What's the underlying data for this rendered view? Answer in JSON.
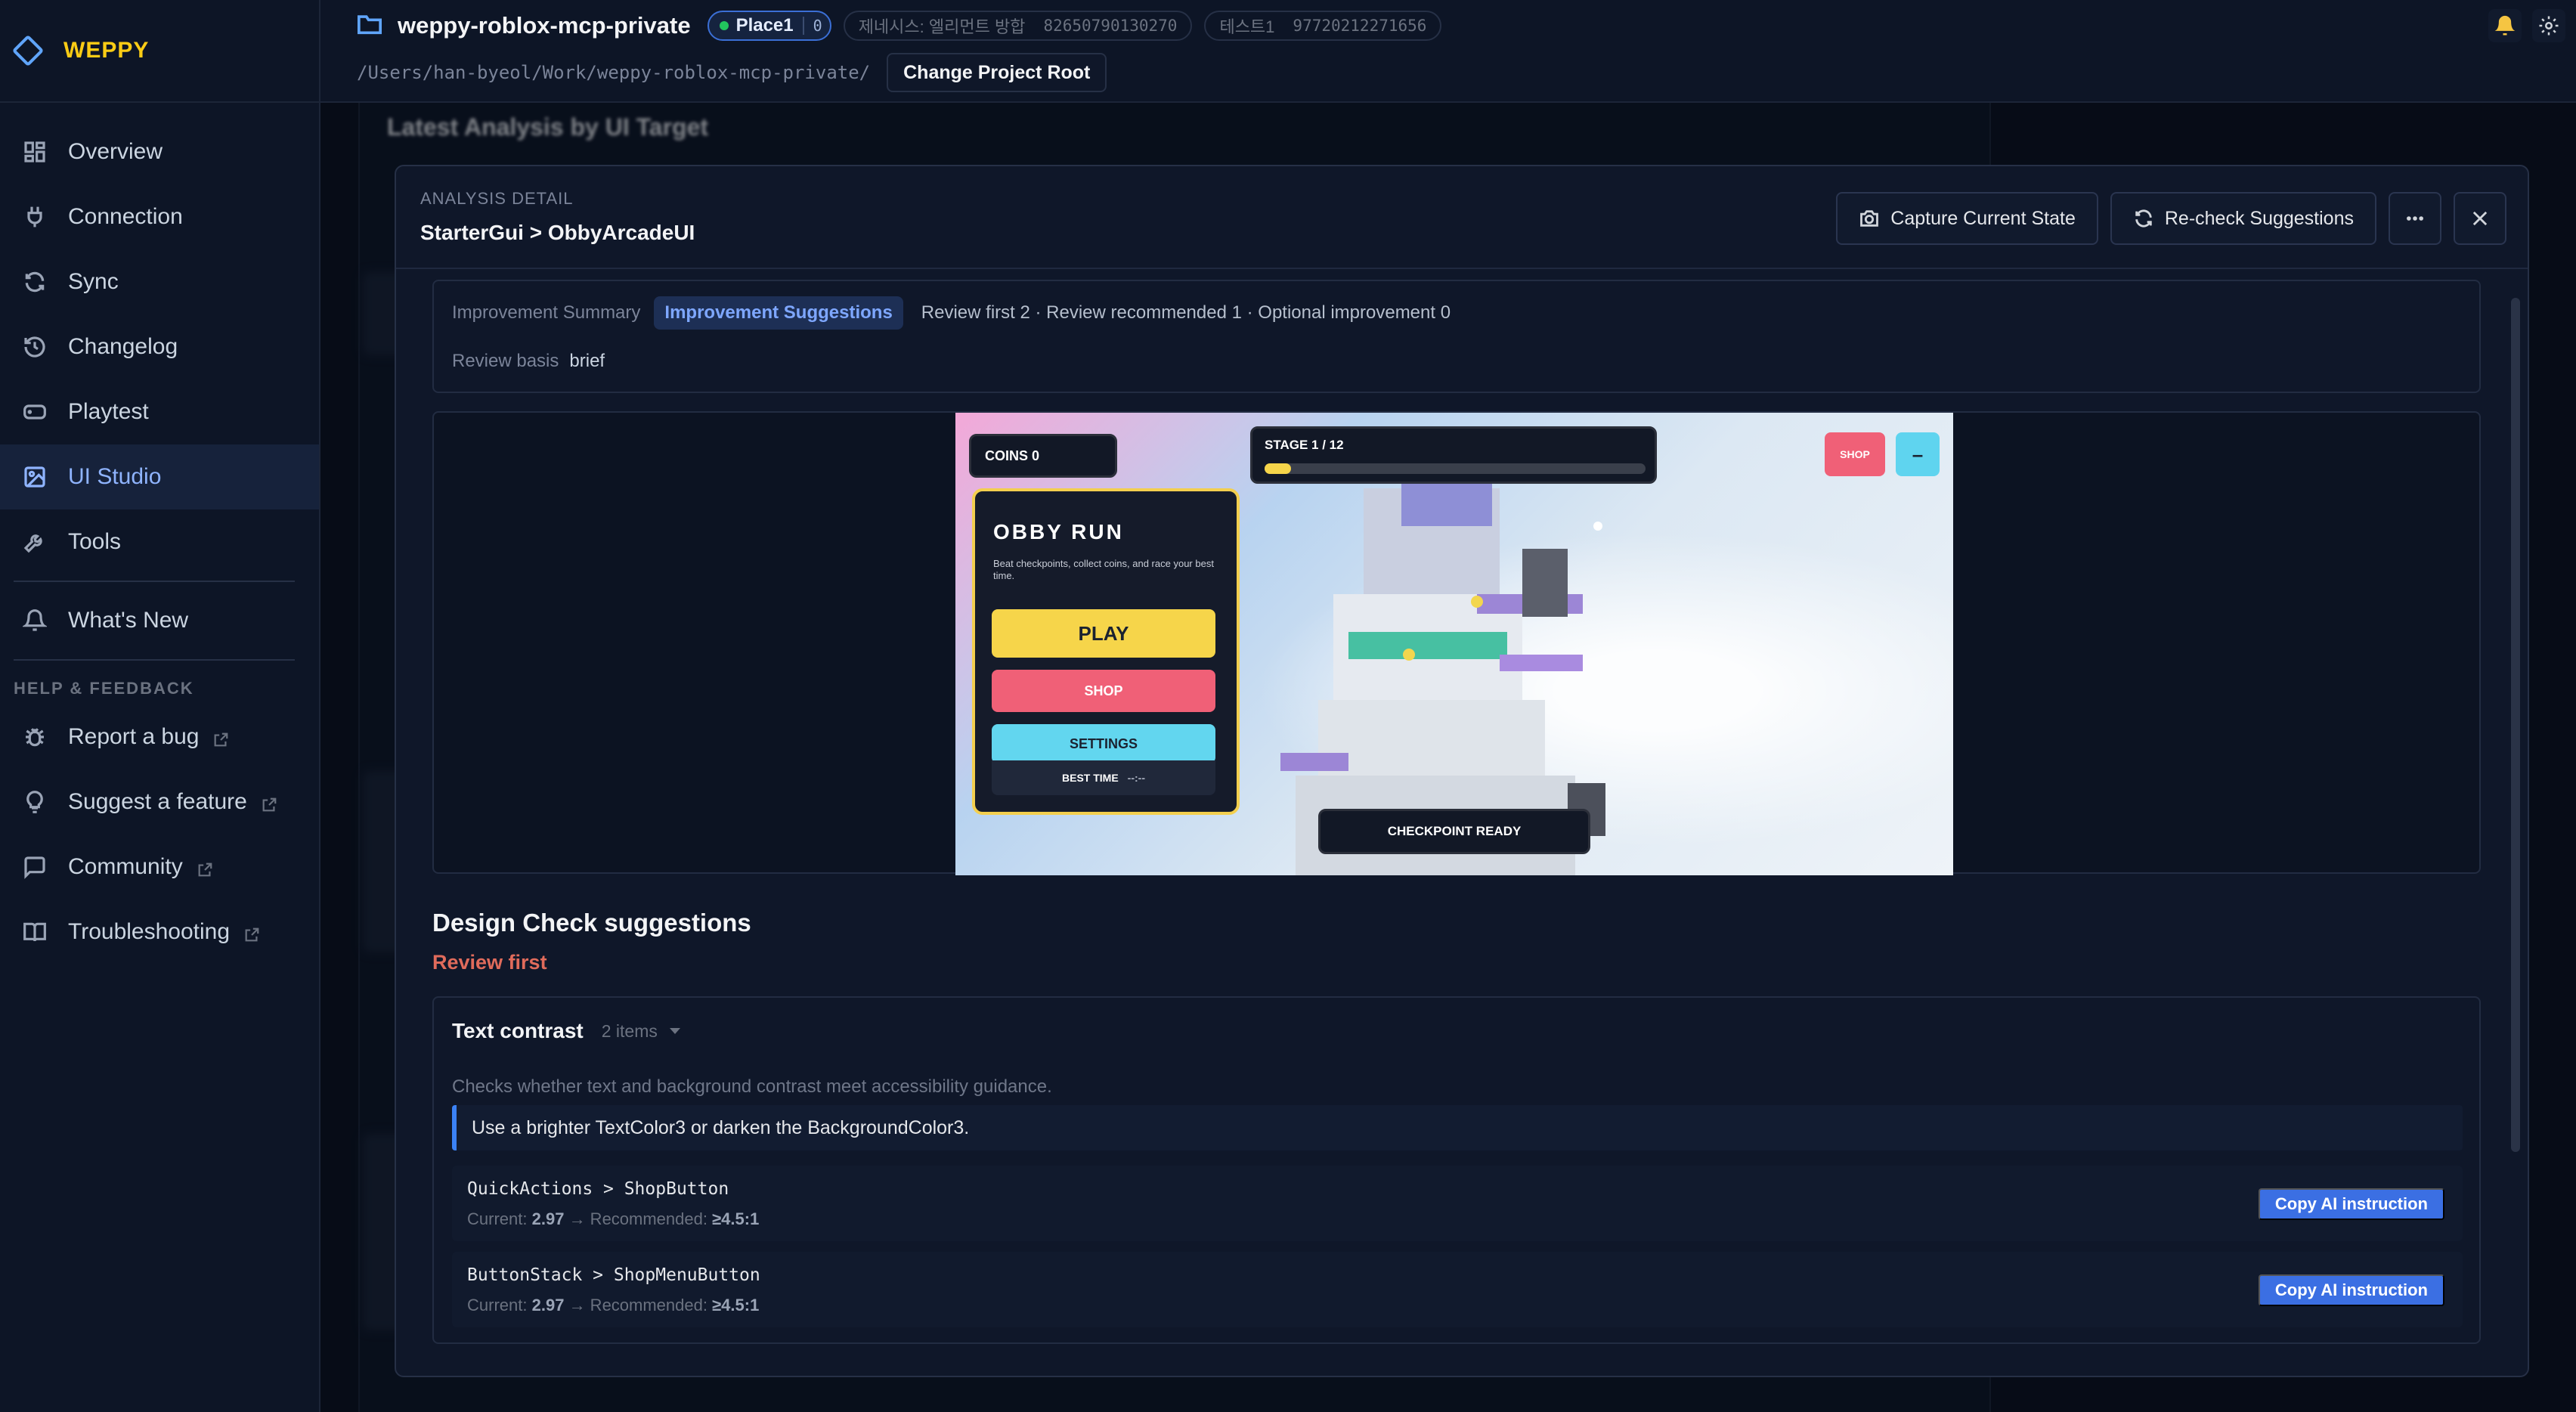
{
  "app": {
    "name": "WEPPY"
  },
  "sidebar": {
    "items": [
      {
        "label": "Overview"
      },
      {
        "label": "Connection"
      },
      {
        "label": "Sync"
      },
      {
        "label": "Changelog"
      },
      {
        "label": "Playtest"
      },
      {
        "label": "UI Studio"
      },
      {
        "label": "Tools"
      }
    ],
    "whats_new": "What's New",
    "help_section": "HELP & FEEDBACK",
    "help_items": [
      {
        "label": "Report a bug"
      },
      {
        "label": "Suggest a feature"
      },
      {
        "label": "Community"
      },
      {
        "label": "Troubleshooting"
      }
    ]
  },
  "header": {
    "project_name": "weppy-roblox-mcp-private",
    "place_label": "Place1",
    "place_count": "0",
    "pill1_name": "제네시스: 엘리먼트 방합",
    "pill1_id": "82650790130270",
    "pill2_name": "테스트1",
    "pill2_id": "97720212271656",
    "path": "/Users/han-byeol/Work/weppy-roblox-mcp-private/",
    "change_root": "Change Project Root"
  },
  "background": {
    "title": "Latest Analysis by UI Target"
  },
  "modal": {
    "kicker": "ANALYSIS DETAIL",
    "title": "StarterGui > ObbyArcadeUI",
    "capture_label": "Capture Current State",
    "recheck_label": "Re-check Suggestions",
    "tabs": {
      "summary_tab": "Improvement Summary",
      "suggestions_tab": "Improvement Suggestions",
      "summary_text": "Review first 2 · Review recommended 1 · Optional improvement 0"
    },
    "basis_label": "Review basis",
    "basis_value": "brief"
  },
  "game": {
    "coins": "COINS 0",
    "stage": "STAGE 1 / 12",
    "stage_progress": 0.07,
    "shop_small": "SHOP",
    "minimize": "–",
    "menu_title": "OBBY RUN",
    "menu_desc": "Beat checkpoints, collect coins, and race your best time.",
    "play": "PLAY",
    "shop": "SHOP",
    "settings": "SETTINGS",
    "best_time_label": "BEST TIME",
    "best_time_value": "--:--",
    "checkpoint": "CHECKPOINT READY"
  },
  "design_check": {
    "title": "Design Check suggestions",
    "review_first": "Review first",
    "card": {
      "name": "Text contrast",
      "count": "2 items",
      "desc": "Checks whether text and background contrast meet accessibility guidance.",
      "tip": "Use a brighter TextColor3 or darken the BackgroundColor3.",
      "rows": [
        {
          "path": "QuickActions > ShopButton",
          "current_label": "Current:",
          "current": "2.97",
          "rec_label": "→ Recommended:",
          "recommended": "≥4.5:1",
          "copy": "Copy AI instruction"
        },
        {
          "path": "ButtonStack > ShopMenuButton",
          "current_label": "Current:",
          "current": "2.97",
          "rec_label": "→ Recommended:",
          "recommended": "≥4.5:1",
          "copy": "Copy AI instruction"
        }
      ]
    }
  },
  "colors": {
    "accent": "#3b82f6",
    "brand": "#facc15",
    "warning": "#e06b5b",
    "active_nav": "#8fb4ff"
  }
}
